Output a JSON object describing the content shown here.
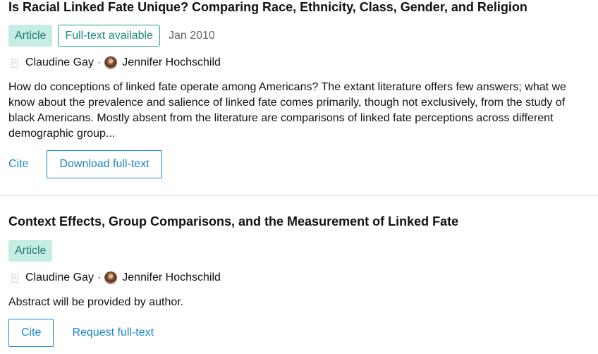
{
  "results": [
    {
      "title": "Is Racial Linked Fate Unique? Comparing Race, Ethnicity, Class, Gender, and Religion",
      "type_label": "Article",
      "fulltext_label": "Full-text available",
      "date": "Jan 2010",
      "authors": [
        "Claudine Gay",
        "Jennifer Hochschild"
      ],
      "author_separator": "·",
      "abstract": "How do conceptions of linked fate operate among Americans? The extant literature offers few answers; what we know about the prevalence and salience of linked fate comes primarily, though not exclusively, from the study of black Americans. Mostly absent from the literature are comparisons of linked fate perceptions across different demographic group...",
      "cite_label": "Cite",
      "fulltext_action_label": "Download full-text"
    },
    {
      "title": "Context Effects, Group Comparisons, and the Measurement of Linked Fate",
      "type_label": "Article",
      "authors": [
        "Claudine Gay",
        "Jennifer Hochschild"
      ],
      "author_separator": "·",
      "abstract": "Abstract will be provided by author.",
      "cite_label": "Cite",
      "fulltext_action_label": "Request full-text"
    }
  ],
  "colors": {
    "accent": "#1a86c8",
    "tag_bg": "#c6ece6",
    "tag_text": "#1f7d6f",
    "tag_border": "#1fa28c",
    "divider": "#e3e3e3"
  }
}
